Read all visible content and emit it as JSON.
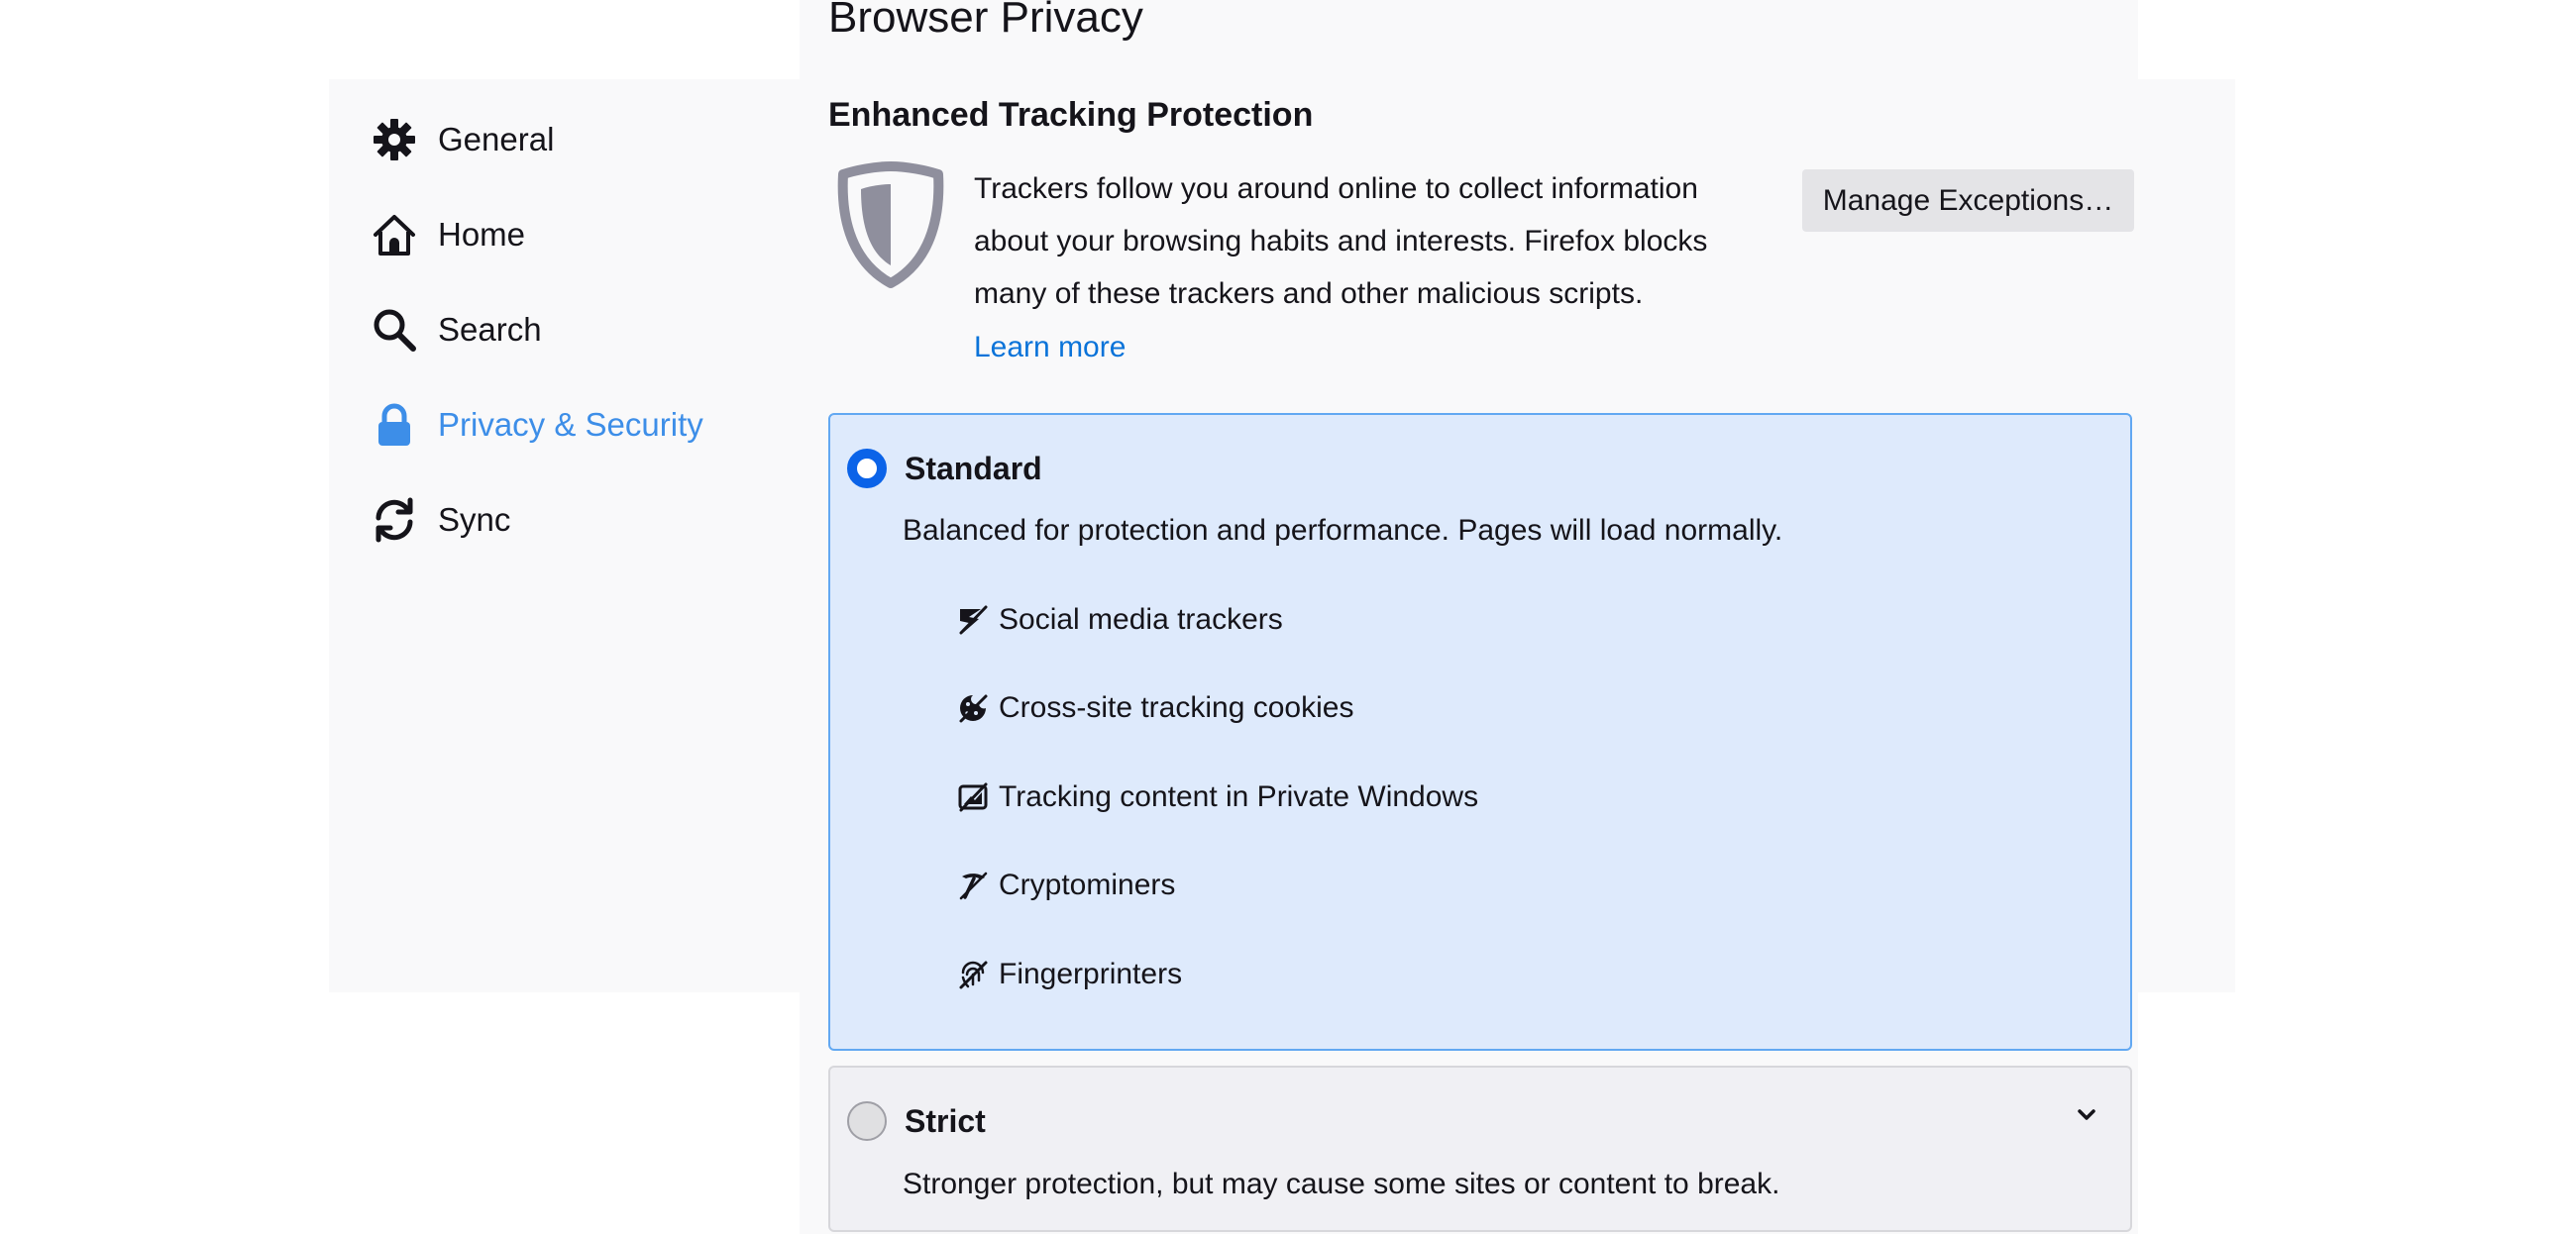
{
  "page": {
    "title": "Browser Privacy"
  },
  "sidebar": {
    "items": [
      {
        "label": "General",
        "icon": "gear-icon"
      },
      {
        "label": "Home",
        "icon": "home-icon"
      },
      {
        "label": "Search",
        "icon": "search-icon"
      },
      {
        "label": "Privacy & Security",
        "icon": "lock-icon",
        "selected": true
      },
      {
        "label": "Sync",
        "icon": "sync-icon"
      }
    ]
  },
  "tracking": {
    "heading": "Enhanced Tracking Protection",
    "description": "Trackers follow you around online to collect information about your browsing habits and interests. Firefox blocks many of these trackers and other malicious scripts.",
    "learn_more": "Learn more",
    "manage_button": "Manage Exceptions…",
    "options": {
      "standard": {
        "title": "Standard",
        "selected": true,
        "description": "Balanced for protection and performance. Pages will load normally.",
        "features": [
          {
            "label": "Social media trackers",
            "icon": "social-tracker-blocked-icon"
          },
          {
            "label": "Cross-site tracking cookies",
            "icon": "cookie-blocked-icon"
          },
          {
            "label": "Tracking content in Private Windows",
            "icon": "tracking-content-blocked-icon"
          },
          {
            "label": "Cryptominers",
            "icon": "cryptominer-blocked-icon"
          },
          {
            "label": "Fingerprinters",
            "icon": "fingerprinter-blocked-icon"
          }
        ]
      },
      "strict": {
        "title": "Strict",
        "selected": false,
        "description": "Stronger protection, but may cause some sites or content to break."
      }
    }
  },
  "colors": {
    "accent": "#0b63e8",
    "link": "#0a73d9",
    "selected_nav": "#3d8ee8",
    "standard_bg": "#deeafc",
    "standard_border": "#62a8f2"
  }
}
